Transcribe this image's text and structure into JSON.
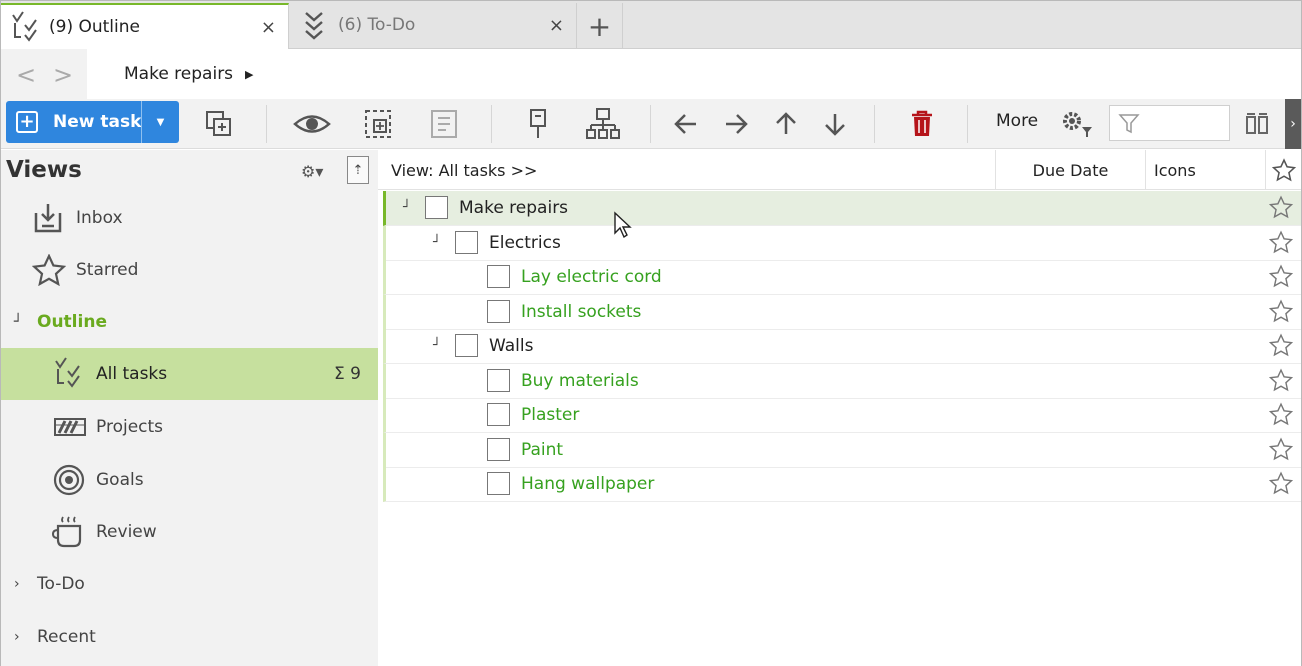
{
  "tabs": [
    {
      "label": "(9) Outline",
      "close": "×",
      "icon": "all-tasks-icon",
      "active": true
    },
    {
      "label": "(6) To-Do",
      "close": "×",
      "icon": "todo-chevrons-icon",
      "active": false
    }
  ],
  "tab_add": "+",
  "nav": {
    "back": "<",
    "forward": ">",
    "breadcrumb": "Make repairs",
    "breadcrumb_caret": "▶"
  },
  "toolbar": {
    "new_task_label": "New task",
    "new_task_plus": "+",
    "new_task_dropdown": "▼",
    "more_label": "More",
    "filter_placeholder": "",
    "scroll_right": "›",
    "icons": [
      "duplicate-icon",
      "view-eye-icon",
      "add-subtask-icon",
      "add-note-icon",
      "pin-icon",
      "hierarchy-icon",
      "arrow-left-icon",
      "arrow-right-icon",
      "arrow-up-icon",
      "arrow-down-icon",
      "delete-trash-icon",
      "gear-filter-icon",
      "filter-icon",
      "columns-icon"
    ]
  },
  "sidebar": {
    "title": "Views",
    "gear": "⚙▾",
    "pin": "⇡",
    "items": [
      {
        "label": "Inbox",
        "icon": "inbox-icon"
      },
      {
        "label": "Starred",
        "icon": "star-icon"
      },
      {
        "label": "Outline",
        "icon": "collapse-icon",
        "caret": "┘"
      },
      {
        "label": "All tasks",
        "icon": "all-tasks-icon",
        "count": "Σ 9",
        "selected": true
      },
      {
        "label": "Projects",
        "icon": "projects-icon"
      },
      {
        "label": "Goals",
        "icon": "goals-target-icon"
      },
      {
        "label": "Review",
        "icon": "review-coffee-icon"
      },
      {
        "label": "To-Do",
        "caret": "›"
      },
      {
        "label": "Recent",
        "caret": "›"
      }
    ]
  },
  "main": {
    "view_label": "View: All tasks >>",
    "col_due": "Due Date",
    "col_icons": "Icons",
    "tasks": [
      {
        "label": "Make repairs",
        "level": 0,
        "type": "parent",
        "exp": "┘"
      },
      {
        "label": "Electrics",
        "level": 1,
        "type": "parent",
        "exp": "┘"
      },
      {
        "label": "Lay electric cord",
        "level": 2,
        "type": "leaf"
      },
      {
        "label": "Install sockets",
        "level": 2,
        "type": "leaf"
      },
      {
        "label": "Walls",
        "level": 1,
        "type": "parent",
        "exp": "┘"
      },
      {
        "label": "Buy materials",
        "level": 2,
        "type": "leaf"
      },
      {
        "label": "Plaster",
        "level": 2,
        "type": "leaf"
      },
      {
        "label": "Paint",
        "level": 2,
        "type": "leaf"
      },
      {
        "label": "Hang wallpaper",
        "level": 2,
        "type": "leaf"
      }
    ]
  },
  "colors": {
    "accent_green": "#78b82a",
    "leaf_green": "#36a11f",
    "selection": "#c6e09e",
    "brand_blue": "#2f86de",
    "delete_red": "#b5141a"
  }
}
